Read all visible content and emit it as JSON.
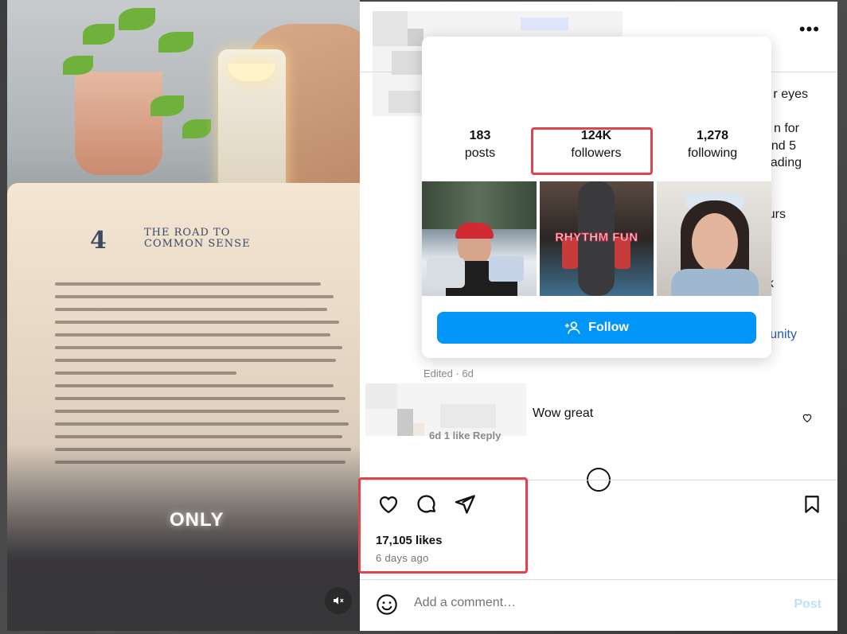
{
  "media": {
    "chapter_number": "4",
    "chapter_title_line1": "THE ROAD TO",
    "chapter_title_line2": "COMMON SENSE",
    "overlay_text": "ONLY"
  },
  "header": {
    "more_label": "•••"
  },
  "caption": {
    "fragments": [
      "r eyes",
      "n for",
      "nd 5",
      "ading",
      "urs",
      "lk"
    ],
    "link_fragment": "unity"
  },
  "hovercard": {
    "stats": [
      {
        "value": "183",
        "label": "posts"
      },
      {
        "value": "124K",
        "label": "followers"
      },
      {
        "value": "1,278",
        "label": "following"
      }
    ],
    "thumb2_caption": "RHYTHM FUN",
    "follow_label": "Follow"
  },
  "edited_label": "Edited · 6d",
  "comment": {
    "text": "Wow great",
    "meta": "6d   1 like   Reply"
  },
  "actions": {
    "likes": "17,105 likes",
    "time_ago": "6 days ago"
  },
  "comment_bar": {
    "placeholder": "Add a comment…",
    "post_label": "Post"
  },
  "colors": {
    "follow_button": "#0095f6",
    "highlight": "#e0434a",
    "post_disabled": "#c0dffd"
  }
}
